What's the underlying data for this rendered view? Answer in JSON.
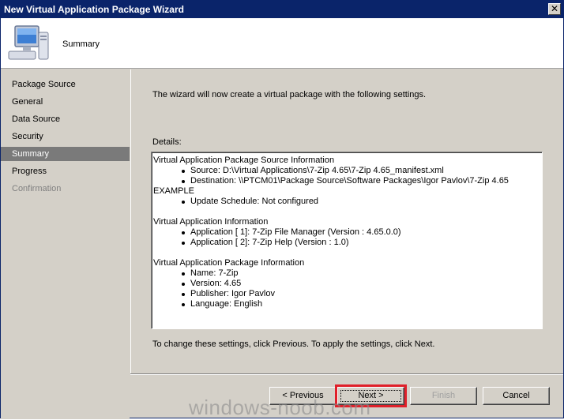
{
  "window": {
    "title": "New Virtual Application Package Wizard",
    "close_glyph": "✕"
  },
  "header": {
    "title": "Summary",
    "icon": "computer-icon"
  },
  "nav": {
    "items": [
      {
        "label": "Package Source",
        "state": "normal"
      },
      {
        "label": "General",
        "state": "normal"
      },
      {
        "label": "Data Source",
        "state": "normal"
      },
      {
        "label": "Security",
        "state": "normal"
      },
      {
        "label": "Summary",
        "state": "active"
      },
      {
        "label": "Progress",
        "state": "normal"
      },
      {
        "label": "Confirmation",
        "state": "disabled"
      }
    ]
  },
  "main": {
    "intro": "The wizard will now create a virtual package with the following settings.",
    "details_label": "Details:",
    "details": {
      "section1_title": "Virtual Application Package Source Information",
      "section1_items": [
        "Source: D:\\Virtual Applications\\7-Zip 4.65\\7-Zip 4.65_manifest.xml",
        "Destination: \\\\PTCM01\\Package Source\\Software Packages\\Igor Pavlov\\7-Zip 4.65",
        "Update Schedule: Not configured"
      ],
      "section1_item2_cont": "EXAMPLE",
      "section2_title": "Virtual Application Information",
      "section2_items": [
        "Application [  1]: 7-Zip File Manager (Version : 4.65.0.0)",
        "Application [  2]: 7-Zip Help (Version : 1.0)"
      ],
      "section3_title": "Virtual Application Package Information",
      "section3_items": [
        "Name: 7-Zip",
        "Version: 4.65",
        "Publisher: Igor Pavlov",
        "Language: English"
      ]
    },
    "footer_note": "To change these settings, click Previous. To apply the settings, click Next."
  },
  "buttons": {
    "previous": "< Previous",
    "next": "Next >",
    "finish": "Finish",
    "cancel": "Cancel"
  },
  "watermark": "windows-noob.com",
  "colors": {
    "titlebar": "#0a246a",
    "highlight": "#e0202a",
    "nav_active": "#7a7a7a"
  }
}
